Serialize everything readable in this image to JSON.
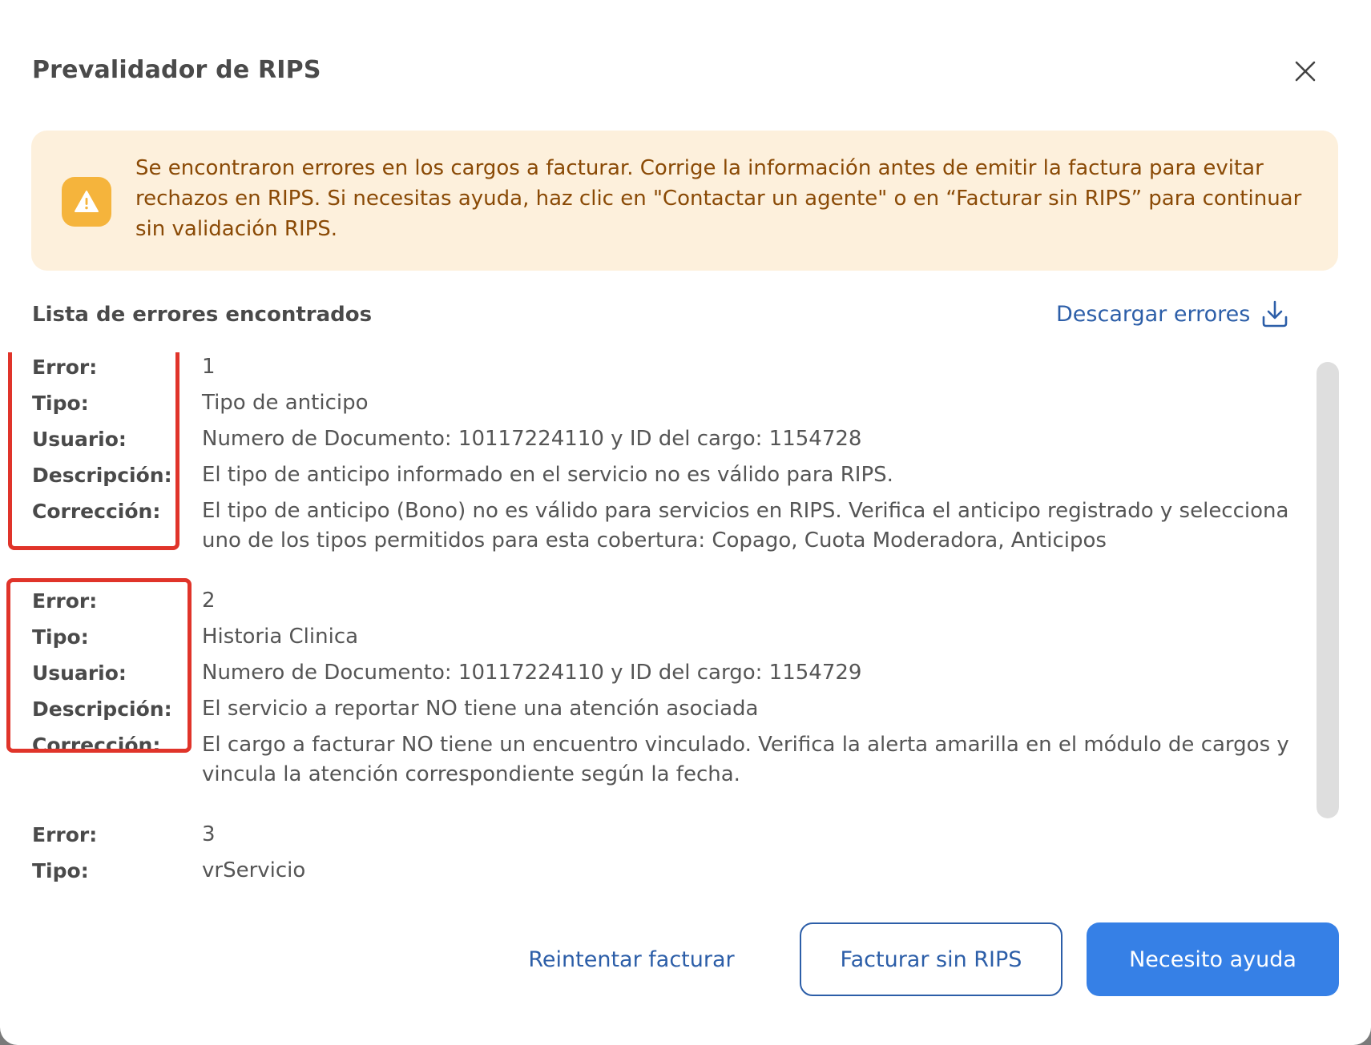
{
  "dialog": {
    "title": "Prevalidador de RIPS"
  },
  "alert": {
    "message": "Se encontraron errores en los cargos a facturar. Corrige la información antes de emitir la factura para evitar rechazos en RIPS. Si necesitas ayuda, haz clic en \"Contactar un agente\" o en “Facturar sin RIPS” para continuar sin validación RIPS.",
    "icon": "warning-icon",
    "background_color": "#fdf0dc",
    "icon_color": "#f5b43c"
  },
  "errors_section": {
    "title": "Lista de errores encontrados",
    "download_label": "Descargar errores"
  },
  "labels": {
    "error": "Error:",
    "tipo": "Tipo:",
    "usuario": "Usuario:",
    "descripcion": "Descripción:",
    "correccion": "Corrección:"
  },
  "errors": [
    {
      "error": "1",
      "tipo": "Tipo de anticipo",
      "usuario": "Numero de Documento: 10117224110 y ID del cargo: 1154728",
      "descripcion": "El tipo de anticipo informado en el servicio no es válido para RIPS.",
      "correccion": "El tipo de anticipo (Bono) no es válido para servicios en RIPS. Verifica el anticipo registrado y selecciona uno de los tipos permitidos para esta cobertura: Copago, Cuota Moderadora, Anticipos"
    },
    {
      "error": "2",
      "tipo": "Historia Clinica",
      "usuario": "Numero de Documento: 10117224110 y ID del cargo: 1154729",
      "descripcion": "El servicio a reportar NO tiene una atención asociada",
      "correccion": "El cargo a facturar NO tiene un encuentro vinculado. Verifica la alerta amarilla en el módulo de cargos y vincula la atención correspondiente según la fecha."
    },
    {
      "error": "3",
      "tipo": "vrServicio"
    }
  ],
  "footer": {
    "retry_label": "Reintentar facturar",
    "no_rips_label": "Facturar sin RIPS",
    "help_label": "Necesito ayuda"
  },
  "colors": {
    "primary": "#3680e6",
    "link": "#2c5ea8",
    "highlight": "#e0342a"
  }
}
